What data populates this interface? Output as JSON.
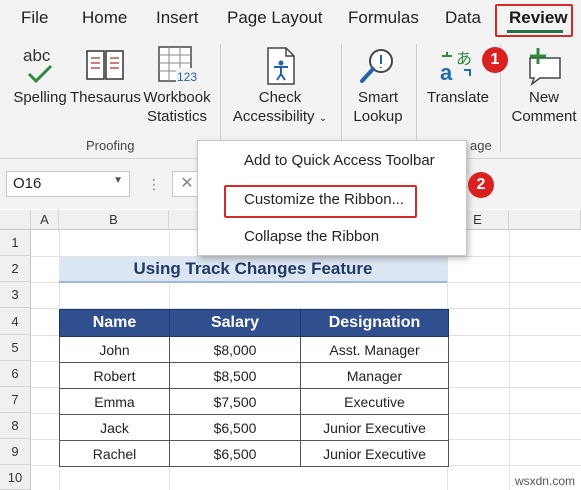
{
  "tabs": [
    "File",
    "Home",
    "Insert",
    "Page Layout",
    "Formulas",
    "Data",
    "Review"
  ],
  "ribbon": {
    "spelling": "Spelling",
    "thesaurus": "Thesaurus",
    "workbook_stats": [
      "Workbook",
      "Statistics"
    ],
    "check_accessibility": [
      "Check",
      "Accessibility"
    ],
    "smart_lookup": [
      "Smart",
      "Lookup"
    ],
    "translate": "Translate",
    "new_comment": [
      "New",
      "Comment"
    ],
    "proofing_group": "Proofing",
    "language_group_partial": "age",
    "abc_icon_text": "abc",
    "stats_icon_num": "123"
  },
  "context_menu": {
    "items": [
      "Add to Quick Access Toolbar",
      "Customize the Ribbon...",
      "Collapse the Ribbon"
    ]
  },
  "formula_bar": {
    "name_box": "O16"
  },
  "columns": [
    "A",
    "B",
    "E"
  ],
  "rows": [
    "1",
    "2",
    "3",
    "4",
    "5",
    "6",
    "7",
    "8",
    "9",
    "10"
  ],
  "sheet": {
    "title": "Using Track Changes Feature",
    "headers": [
      "Name",
      "Salary",
      "Designation"
    ],
    "rows": [
      [
        "John",
        "$8,000",
        "Asst. Manager"
      ],
      [
        "Robert",
        "$8,500",
        "Manager"
      ],
      [
        "Emma",
        "$7,500",
        "Executive"
      ],
      [
        "Jack",
        "$6,500",
        "Junior Executive"
      ],
      [
        "Rachel",
        "$6,500",
        "Junior Executive"
      ]
    ]
  },
  "badges": [
    "1",
    "2"
  ],
  "colors": {
    "review_underline": "#217346",
    "callout_red": "#d42a2a",
    "table_header": "#2f4f8f",
    "title_fill": "#dce6f2"
  },
  "watermark": "wsxdn.com"
}
